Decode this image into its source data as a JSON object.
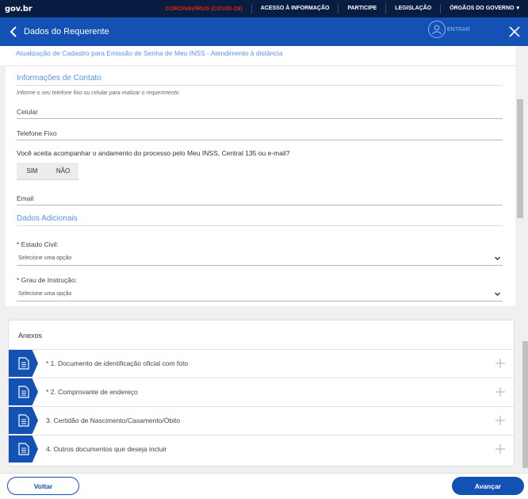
{
  "govbar": {
    "logo": "gov.br",
    "links": [
      {
        "label": "CORONAVÍRUS (COVID-19)"
      },
      {
        "label": "ACESSO À INFORMAÇÃO"
      },
      {
        "label": "PARTICIPE"
      },
      {
        "label": "LEGISLAÇÃO"
      },
      {
        "label": "ÓRGÃOS DO GOVERNO"
      }
    ]
  },
  "header": {
    "title": "Dados do Requerente",
    "entrar": "ENTRAR"
  },
  "subtitle": "Atualização de Cadastro para Emissão de Senha de Meu INSS - Atendimento à distância",
  "contato": {
    "title": "Informações de Contato",
    "hint": "Informe o seu telefone fixo ou celular para realizar o requerimento",
    "celular_label": "Celular",
    "telefone_label": "Telefone Fixo",
    "question": "Você aceita acompanhar o andamento do processo pelo Meu INSS, Central 135 ou e-mail?",
    "sim": "SIM",
    "nao": "NÃO",
    "email_label": "Email"
  },
  "adicionais": {
    "title": "Dados Adicionais",
    "estado_civil_label": "* Estado Civil:",
    "estado_civil_value": "Selecione uma opção",
    "grau_label": "* Grau de Instrução:",
    "grau_value": "Selecione uma opção"
  },
  "anexos": {
    "title": "Anexos",
    "items": [
      {
        "label": "* 1. Documento de identificação oficial com foto"
      },
      {
        "label": "* 2. Comprovante de endereço"
      },
      {
        "label": "3. Certidão de Nascimento/Casamento/Óbito"
      },
      {
        "label": "4. Outros documentos que deseja incluir"
      }
    ]
  },
  "footer": {
    "voltar": "Voltar",
    "avancar": "Avançar"
  },
  "colors": {
    "govbar_bg": "#071d41",
    "primary": "#1351b4",
    "accent_text": "#5992ed",
    "covid": "#e52207"
  }
}
